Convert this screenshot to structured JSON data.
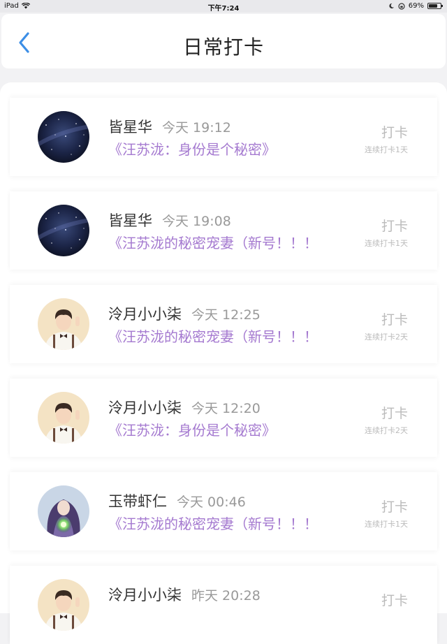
{
  "status_bar": {
    "device": "iPad",
    "time": "下午7:24",
    "battery": "69%",
    "battery_level": 0.69
  },
  "header": {
    "title": "日常打卡",
    "back_icon": "chevron-left-icon"
  },
  "colors": {
    "accent": "#3c8ee6",
    "book_title": "#a57ad0",
    "muted": "#bbbbbb"
  },
  "entries": [
    {
      "user": "皆星华",
      "time": "今天 19:12",
      "book": "《汪苏泷：身份是个秘密》",
      "action": "打卡",
      "streak": "连续打卡1天",
      "avatar": "galaxy"
    },
    {
      "user": "皆星华",
      "time": "今天 19:08",
      "book": "《汪苏泷的秘密宠妻（新号！！！",
      "action": "打卡",
      "streak": "连续打卡1天",
      "avatar": "galaxy"
    },
    {
      "user": "泠月小小柒",
      "time": "今天 12:25",
      "book": "《汪苏泷的秘密宠妻（新号！！！",
      "action": "打卡",
      "streak": "连续打卡2天",
      "avatar": "boy"
    },
    {
      "user": "泠月小小柒",
      "time": "今天 12:20",
      "book": "《汪苏泷：身份是个秘密》",
      "action": "打卡",
      "streak": "连续打卡2天",
      "avatar": "boy"
    },
    {
      "user": "玉带虾仁",
      "time": "今天 00:46",
      "book": "《汪苏泷的秘密宠妻（新号！！！",
      "action": "打卡",
      "streak": "连续打卡1天",
      "avatar": "fantasy"
    },
    {
      "user": "泠月小小柒",
      "time": "昨天 20:28",
      "book": "",
      "action": "打卡",
      "streak": "",
      "avatar": "boy"
    }
  ]
}
